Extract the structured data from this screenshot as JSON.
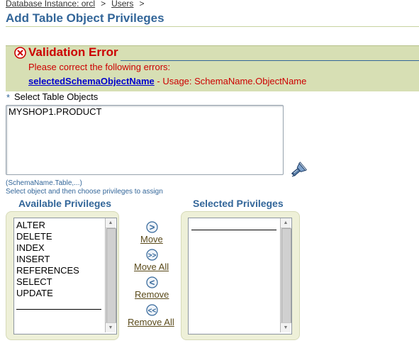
{
  "breadcrumb": {
    "items": [
      "Database Instance: orcl",
      "Users"
    ],
    "separator": ">"
  },
  "page_title": "Add Table Object Privileges",
  "error": {
    "title": "Validation Error",
    "instruction": "Please correct the following errors:",
    "field_link": "selectedSchemaObjectName",
    "message": "- Usage: SchemaName.ObjectName"
  },
  "objects": {
    "required_marker": "*",
    "label": "Select Table Objects",
    "value": "MYSHOP1.PRODUCT",
    "hint_format": "(SchemaName.Table,...)",
    "hint_instruction": "Select object and then choose privileges to assign"
  },
  "shuttle": {
    "available_header": "Available Privileges",
    "selected_header": "Selected Privileges",
    "available_options": [
      "ALTER",
      "DELETE",
      "INDEX",
      "INSERT",
      "REFERENCES",
      "SELECT",
      "UPDATE"
    ],
    "selected_options": [],
    "move_label": "Move",
    "move_all_label": "Move All",
    "remove_label": "Remove",
    "remove_all_label": "Remove All",
    "move_symbol": ">",
    "move_all_symbol": ">>",
    "remove_symbol": "<",
    "remove_all_symbol": "<<"
  },
  "colors": {
    "brand": "#336699",
    "error": "#cc0000",
    "error_bg": "#d7dfb4",
    "link": "#0000cc",
    "shuttle_bg": "#eef0d8"
  }
}
